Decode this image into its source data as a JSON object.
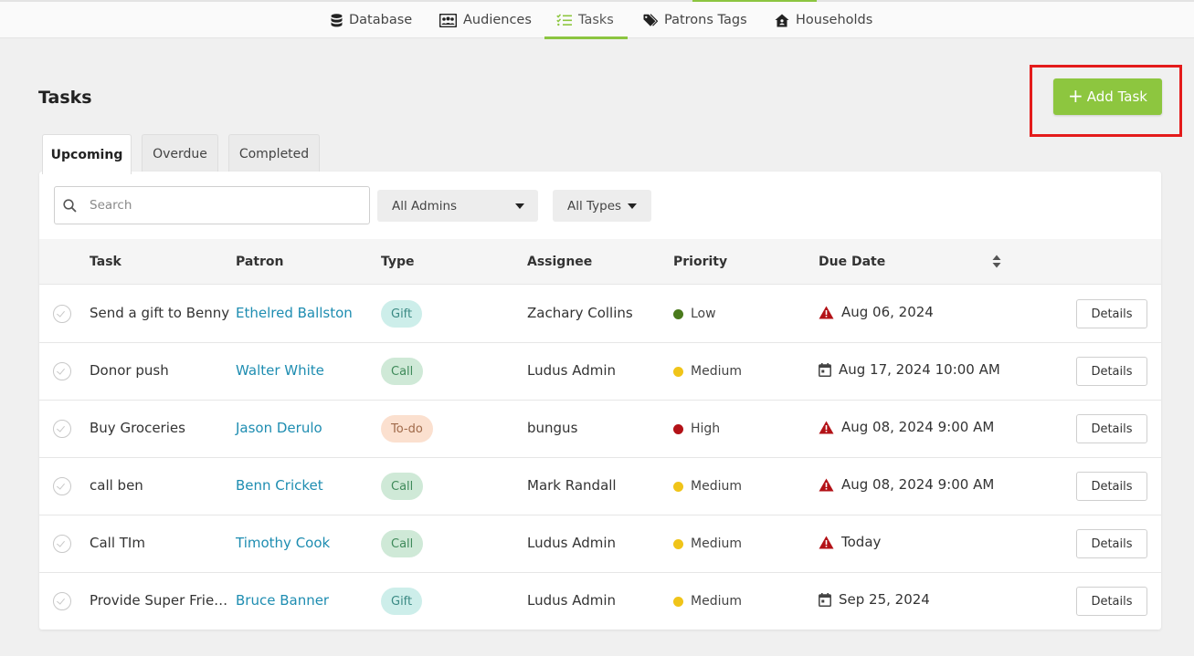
{
  "nav": {
    "items": [
      {
        "label": "Database",
        "icon": "database-icon"
      },
      {
        "label": "Audiences",
        "icon": "audiences-icon"
      },
      {
        "label": "Tasks",
        "icon": "tasks-icon",
        "active": true
      },
      {
        "label": "Patrons Tags",
        "icon": "tag-icon"
      },
      {
        "label": "Households",
        "icon": "household-icon"
      }
    ]
  },
  "page": {
    "title": "Tasks",
    "add_button_label": "Add Task"
  },
  "tabs": [
    "Upcoming",
    "Overdue",
    "Completed"
  ],
  "filters": {
    "search_placeholder": "Search",
    "admins_selected": "All Admins",
    "types_selected": "All Types"
  },
  "table": {
    "columns": [
      "Task",
      "Patron",
      "Type",
      "Assignee",
      "Priority",
      "Due Date"
    ],
    "details_label": "Details",
    "rows": [
      {
        "task": "Send a gift to Benny",
        "patron": "Ethelred Ballston",
        "type": "Gift",
        "assignee": "Zachary Collins",
        "priority": "Low",
        "due": "Aug 06, 2024",
        "due_icon": "warning-icon"
      },
      {
        "task": "Donor push",
        "patron": "Walter White",
        "type": "Call",
        "assignee": "Ludus Admin",
        "priority": "Medium",
        "due": "Aug 17, 2024 10:00 AM",
        "due_icon": "calendar-icon"
      },
      {
        "task": "Buy Groceries",
        "patron": "Jason Derulo",
        "type": "To-do",
        "assignee": "bungus",
        "priority": "High",
        "due": "Aug 08, 2024 9:00 AM",
        "due_icon": "warning-icon"
      },
      {
        "task": "call ben",
        "patron": "Benn Cricket",
        "type": "Call",
        "assignee": "Mark Randall",
        "priority": "Medium",
        "due": "Aug 08, 2024 9:00 AM",
        "due_icon": "warning-icon"
      },
      {
        "task": "Call TIm",
        "patron": "Timothy Cook",
        "type": "Call",
        "assignee": "Ludus Admin",
        "priority": "Medium",
        "due": "Today",
        "due_icon": "warning-icon"
      },
      {
        "task": "Provide Super Friends",
        "patron": "Bruce Banner",
        "type": "Gift",
        "assignee": "Ludus Admin",
        "priority": "Medium",
        "due": "Sep 25, 2024",
        "due_icon": "calendar-icon"
      }
    ]
  },
  "colors": {
    "accent": "#8dc63f",
    "link": "#1e8db1",
    "priority_low": "#4a7a1c",
    "priority_medium": "#f0c419",
    "priority_high": "#b31217",
    "warning": "#b31217",
    "highlight_box": "#e41b1b"
  }
}
